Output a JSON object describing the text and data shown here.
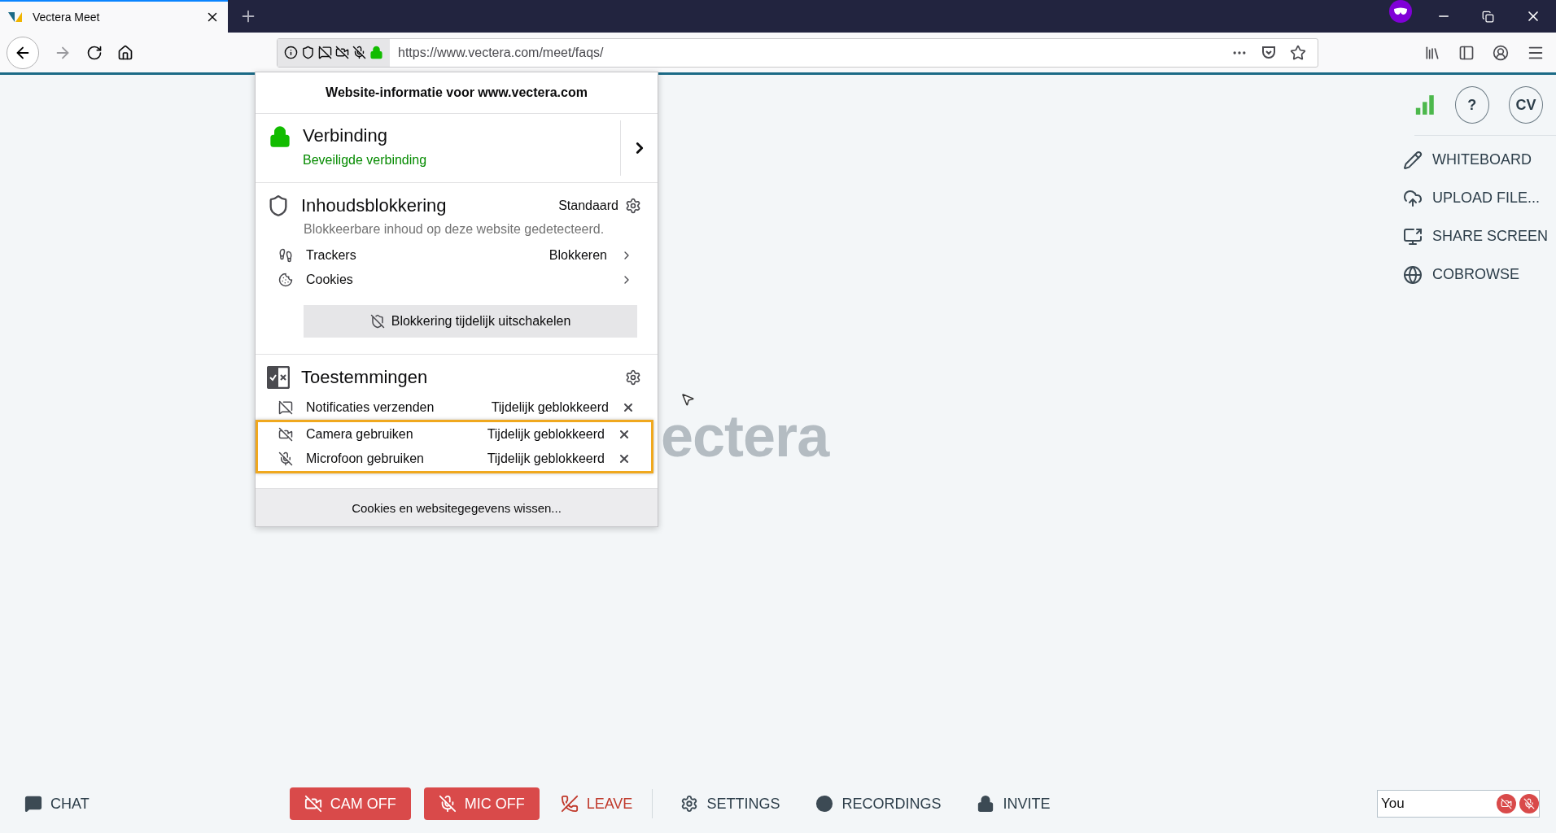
{
  "browser": {
    "tab": {
      "title": "Vectera Meet",
      "selected": true
    },
    "url": "https://www.vectera.com/meet/faqs/"
  },
  "site_info": {
    "title": "Website-informatie voor www.vectera.com",
    "connection": {
      "heading": "Verbinding",
      "status": "Beveiligde verbinding",
      "secure": true
    },
    "blocking": {
      "heading": "Inhoudsblokkering",
      "mode": "Standaard",
      "description": "Blokkeerbare inhoud op deze website gedetecteerd.",
      "items": [
        {
          "label": "Trackers",
          "value": "Blokkeren"
        },
        {
          "label": "Cookies"
        }
      ],
      "button": "Blokkering tijdelijk uitschakelen"
    },
    "permissions": {
      "heading": "Toestemmingen",
      "items": [
        {
          "label": "Notificaties verzenden",
          "state": "Tijdelijk geblokkeerd",
          "highlighted": false
        },
        {
          "label": "Camera gebruiken",
          "state": "Tijdelijk geblokkeerd",
          "highlighted": true
        },
        {
          "label": "Microfoon gebruiken",
          "state": "Tijdelijk geblokkeerd",
          "highlighted": true
        }
      ]
    },
    "footer_button": "Cookies en websitegegevens wissen..."
  },
  "logo_text": "ectera",
  "top_right": {
    "help": "?",
    "avatar": "CV"
  },
  "side_menu": [
    "WHITEBOARD",
    "UPLOAD FILE...",
    "SHARE SCREEN",
    "COBROWSE"
  ],
  "chat": "CHAT",
  "controls": [
    {
      "kind": "danger",
      "label": "CAM OFF"
    },
    {
      "kind": "danger",
      "label": "MIC OFF"
    },
    {
      "kind": "leave",
      "label": "LEAVE"
    },
    {
      "kind": "plain",
      "label": "SETTINGS"
    },
    {
      "kind": "plain",
      "label": "RECORDINGS"
    },
    {
      "kind": "plain",
      "label": "INVITE"
    }
  ],
  "self_view": {
    "name": "You",
    "camera_on": false,
    "mic_on": false
  }
}
